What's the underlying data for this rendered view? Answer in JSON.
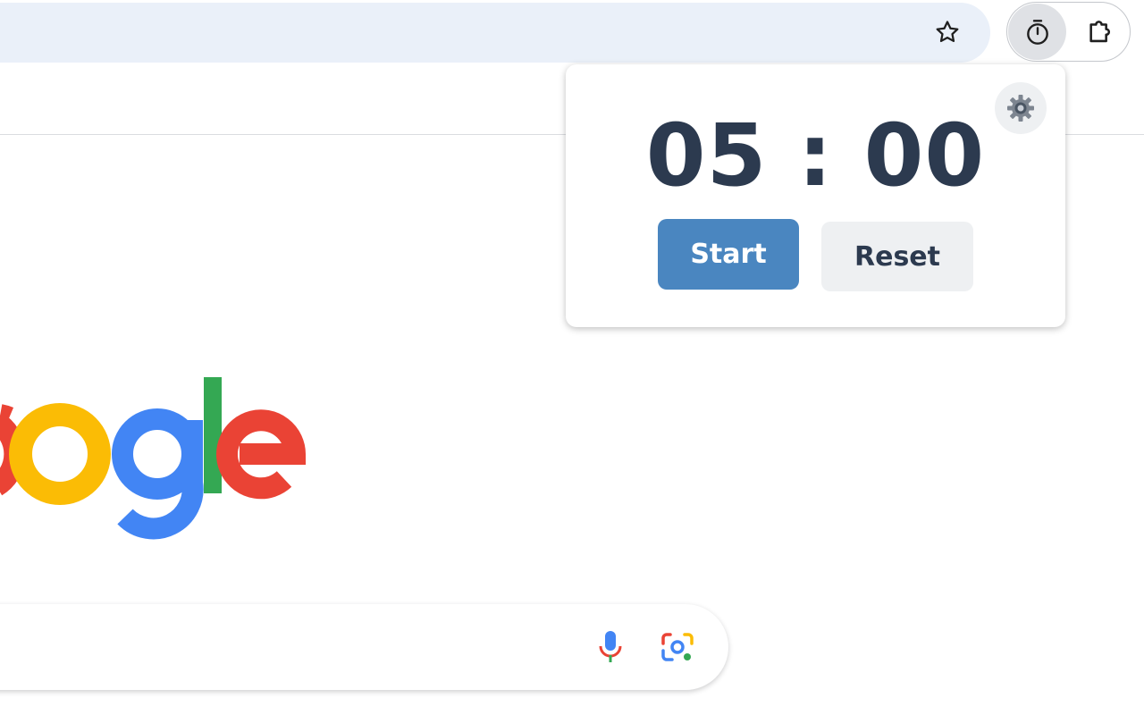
{
  "toolbar": {
    "bookmark_icon": "star-icon",
    "extension_icon": "stopwatch-icon",
    "extensions_menu_icon": "puzzle-icon"
  },
  "search": {
    "voice_icon": "microphone-icon",
    "lens_icon": "camera-lens-icon"
  },
  "logo": {
    "letters": "oogle",
    "colors": {
      "o1": "#ea4335",
      "o2": "#fbbc05",
      "g": "#4285f4",
      "l": "#34a853",
      "e": "#ea4335"
    }
  },
  "timer_popup": {
    "minutes": "05",
    "separator": ":",
    "seconds": "00",
    "time_text": "05 : 00",
    "start_label": "Start",
    "reset_label": "Reset",
    "settings_icon": "gear-icon",
    "colors": {
      "start_bg": "#4a86c0",
      "reset_bg": "#eef0f2",
      "digits": "#2c3a4f"
    }
  }
}
